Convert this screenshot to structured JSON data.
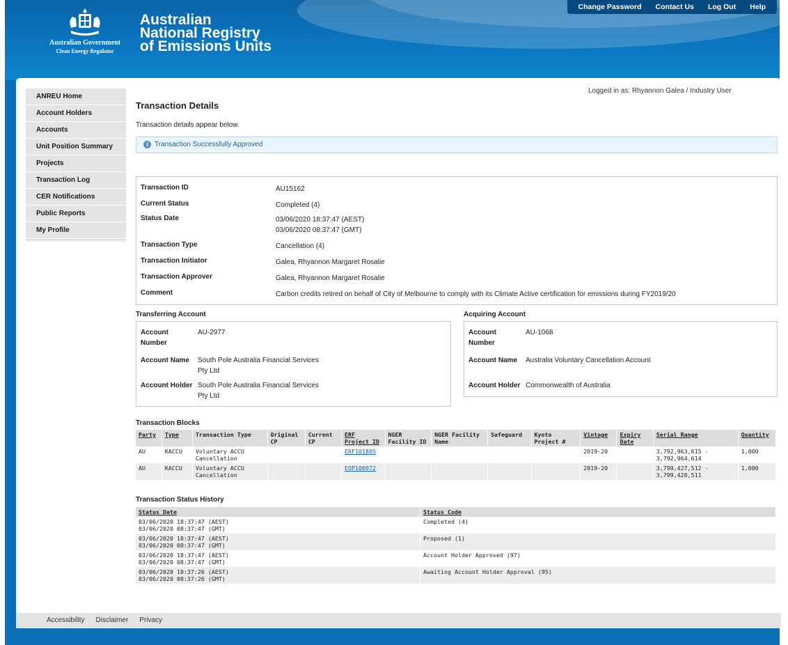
{
  "header": {
    "crest_label": "Australian Government",
    "crest_sub": "Clean Energy Regulator",
    "brand_line1": "Australian",
    "brand_line2": "National Registry",
    "brand_line3": "of Emissions Units",
    "nav": [
      "Change Password",
      "Contact Us",
      "Log Out",
      "Help"
    ]
  },
  "sidebar": {
    "items": [
      "ANREU Home",
      "Account Holders",
      "Accounts",
      "Unit Position Summary",
      "Projects",
      "Transaction Log",
      "CER Notifications",
      "Public Reports",
      "My Profile"
    ]
  },
  "user": {
    "logged_in": "Logged in as:  Rhyannon Galea / Industry User"
  },
  "page": {
    "title": "Transaction Details",
    "intro": "Transaction details appear below.",
    "notice": "Transaction Successfully Approved"
  },
  "details": {
    "transaction_id": {
      "label": "Transaction ID",
      "value": "AU15162"
    },
    "current_status": {
      "label": "Current Status",
      "value": "Completed (4)"
    },
    "status_date": {
      "label": "Status Date",
      "value1": "03/06/2020 18:37:47 (AEST)",
      "value2": "03/06/2020 08:37:47 (GMT)"
    },
    "transaction_type": {
      "label": "Transaction Type",
      "value": "Cancellation (4)"
    },
    "initiator": {
      "label": "Transaction Initiator",
      "value": "Galea, Rhyannon Margaret Rosalie"
    },
    "approver": {
      "label": "Transaction Approver",
      "value": "Galea, Rhyannon Margaret Rosalie"
    },
    "comment": {
      "label": "Comment",
      "value": "Carbon credits retired on behalf of City of Melbourne to comply with its Climate Active certification for emissions during FY2019/20"
    }
  },
  "transferring": {
    "title": "Transferring Account",
    "number_label": "Account Number",
    "number": "AU-2977",
    "name_label": "Account Name",
    "name": "South Pole Australia Financial Services Pty Ltd",
    "holder_label": "Account Holder",
    "holder": "South Pole Australia Financial Services Pty Ltd"
  },
  "acquiring": {
    "title": "Acquiring Account",
    "number_label": "Account Number",
    "number": "AU-1068",
    "name_label": "Account Name",
    "name": "Australia Voluntary Cancellation Account",
    "holder_label": "Account Holder",
    "holder": "Commonwealth of Australia"
  },
  "blocks": {
    "title": "Transaction Blocks",
    "headers": [
      "Party",
      "Type",
      "Transaction Type",
      "Original CP",
      "Current CP",
      "ERF Project ID",
      "NGER Facility ID",
      "NGER Facility Name",
      "Safeguard",
      "Kyoto Project #",
      "Vintage",
      "Expiry Date",
      "Serial Range",
      "Quantity"
    ],
    "rows": [
      [
        "AU",
        "KACCU",
        "Voluntary ACCU Cancellation",
        "",
        "",
        "ERF101805",
        "",
        "",
        "",
        "",
        "2019-20",
        "",
        "3,792,963,615 - 3,792,964,614",
        "1,000"
      ],
      [
        "AU",
        "KACCU",
        "Voluntary ACCU Cancellation",
        "",
        "",
        "EOP100972",
        "",
        "",
        "",
        "",
        "2019-20",
        "",
        "3,799,427,512 - 3,799,428,511",
        "1,000"
      ]
    ]
  },
  "history": {
    "title": "Transaction Status History",
    "headers": [
      "Status Date",
      "Status Code"
    ],
    "rows": [
      [
        "03/06/2020 18:37:47 (AEST)",
        "03/06/2020 08:37:47 (GMT)",
        "Completed (4)"
      ],
      [
        "03/06/2020 18:37:47 (AEST)",
        "03/06/2020 08:37:47 (GMT)",
        "Proposed (1)"
      ],
      [
        "03/06/2020 18:37:47 (AEST)",
        "03/06/2020 08:37:47 (GMT)",
        "Account Holder Approved (97)"
      ],
      [
        "03/06/2020 18:37:26 (AEST)",
        "03/06/2020 08:37:26 (GMT)",
        "Awaiting Account Holder Approval (95)"
      ]
    ]
  },
  "footer": {
    "links": [
      "Accessibility",
      "Disclaimer",
      "Privacy"
    ]
  }
}
